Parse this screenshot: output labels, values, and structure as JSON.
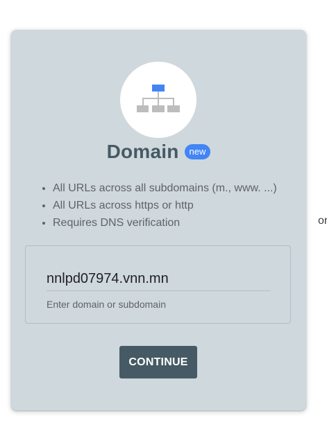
{
  "card": {
    "title": "Domain",
    "badge": "new",
    "icon": "sitemap-icon",
    "features": [
      "All URLs across all subdomains (m., www. ...)",
      "All URLs across https or http",
      "Requires DNS verification"
    ],
    "input": {
      "value": "nnlpd07974.vnn.mn",
      "helper": "Enter domain or subdomain"
    },
    "continue_label": "CONTINUE"
  },
  "side_text": "or",
  "colors": {
    "card_bg": "#cfd8dc",
    "title": "#455a64",
    "badge": "#4285f4",
    "button_bg": "#455a64",
    "icon_top": "#4285f4",
    "icon_nodes": "#bdbdbd"
  }
}
